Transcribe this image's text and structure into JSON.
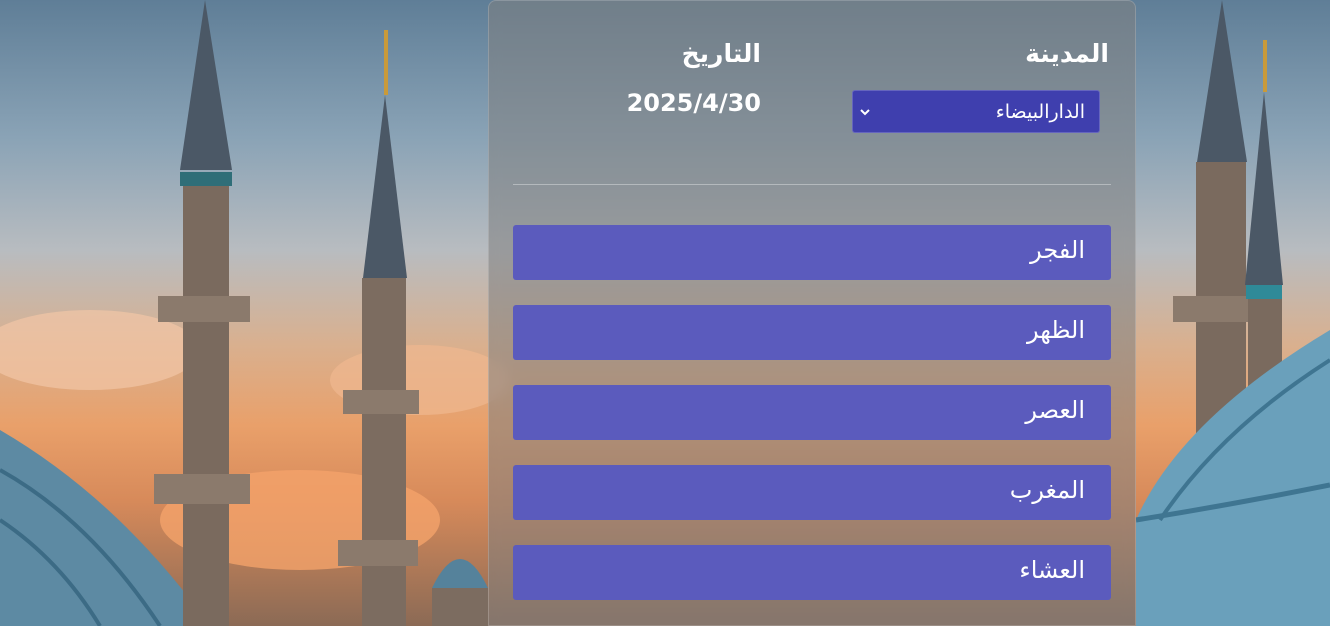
{
  "header": {
    "city_label": "المدينة",
    "date_label": "التاريخ",
    "date_value": "2025/4/30"
  },
  "city_select": {
    "selected": "الدارالبيضاء"
  },
  "prayers": [
    {
      "name": "الفجر"
    },
    {
      "name": "الظهر"
    },
    {
      "name": "العصر"
    },
    {
      "name": "المغرب"
    },
    {
      "name": "العشاء"
    }
  ],
  "colors": {
    "select_bg": "#3f3fae",
    "prayer_bg": "#5b5bbd"
  }
}
